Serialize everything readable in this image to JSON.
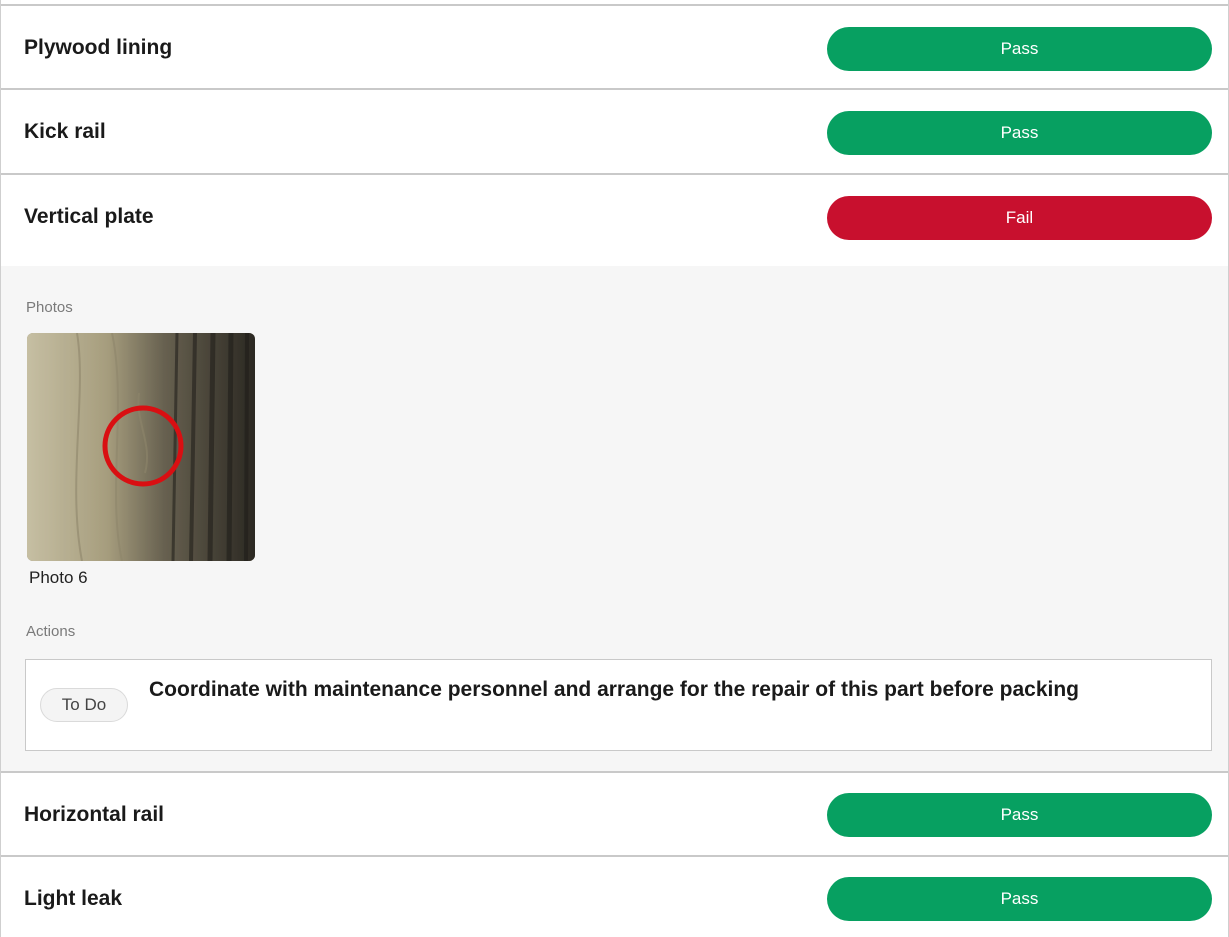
{
  "checklist": [
    {
      "label": "Plywood lining",
      "status": "Pass"
    },
    {
      "label": "Kick rail",
      "status": "Pass"
    },
    {
      "label": "Vertical plate",
      "status": "Fail"
    },
    {
      "label": "Horizontal rail",
      "status": "Pass"
    },
    {
      "label": "Light leak",
      "status": "Pass"
    }
  ],
  "details": {
    "photos_label": "Photos",
    "photo_caption": "Photo 6",
    "actions_label": "Actions",
    "action_status": "To Do",
    "action_text": "Coordinate with maintenance personnel and arrange for the repair of this part before packing"
  },
  "colors": {
    "pass": "#07a061",
    "fail": "#c8102e"
  }
}
